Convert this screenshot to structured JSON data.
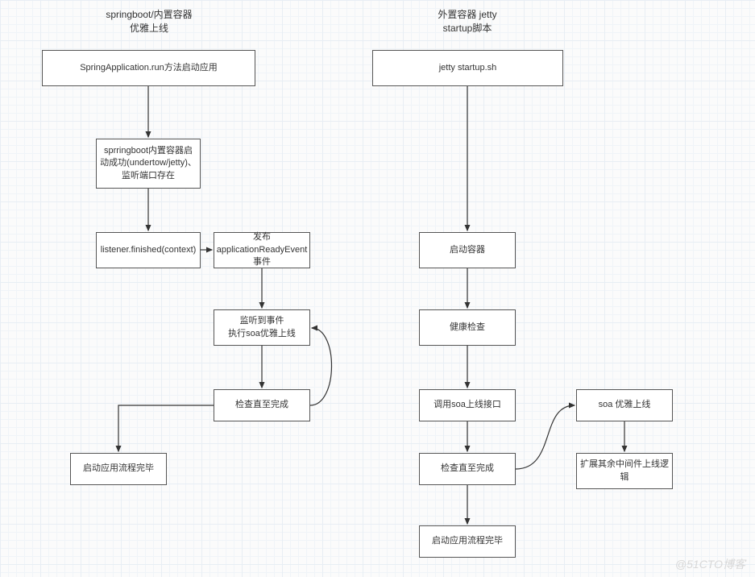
{
  "left": {
    "title": "springboot/内置容器\n优雅上线",
    "box1": "SpringApplication.run方法启动应用",
    "box2": "sprringboot内置容器启动成功(undertow/jetty)、监听端口存在",
    "box3": "listener.finished(context)",
    "box4": "发布applicationReadyEvent事件",
    "box5": "监听到事件\n执行soa优雅上线",
    "box6": "检查直至完成",
    "box7": "启动应用流程完毕"
  },
  "right": {
    "title": "外置容器 jetty\nstartup脚本",
    "box1": "jetty startup.sh",
    "box2": "启动容器",
    "box3": "健康检查",
    "box4": "调用soa上线接口",
    "box5": "soa 优雅上线",
    "box6": "检查直至完成",
    "box7": "扩展其余中间件上线逻辑",
    "box8": "启动应用流程完毕"
  },
  "watermark": "@51CTO博客"
}
